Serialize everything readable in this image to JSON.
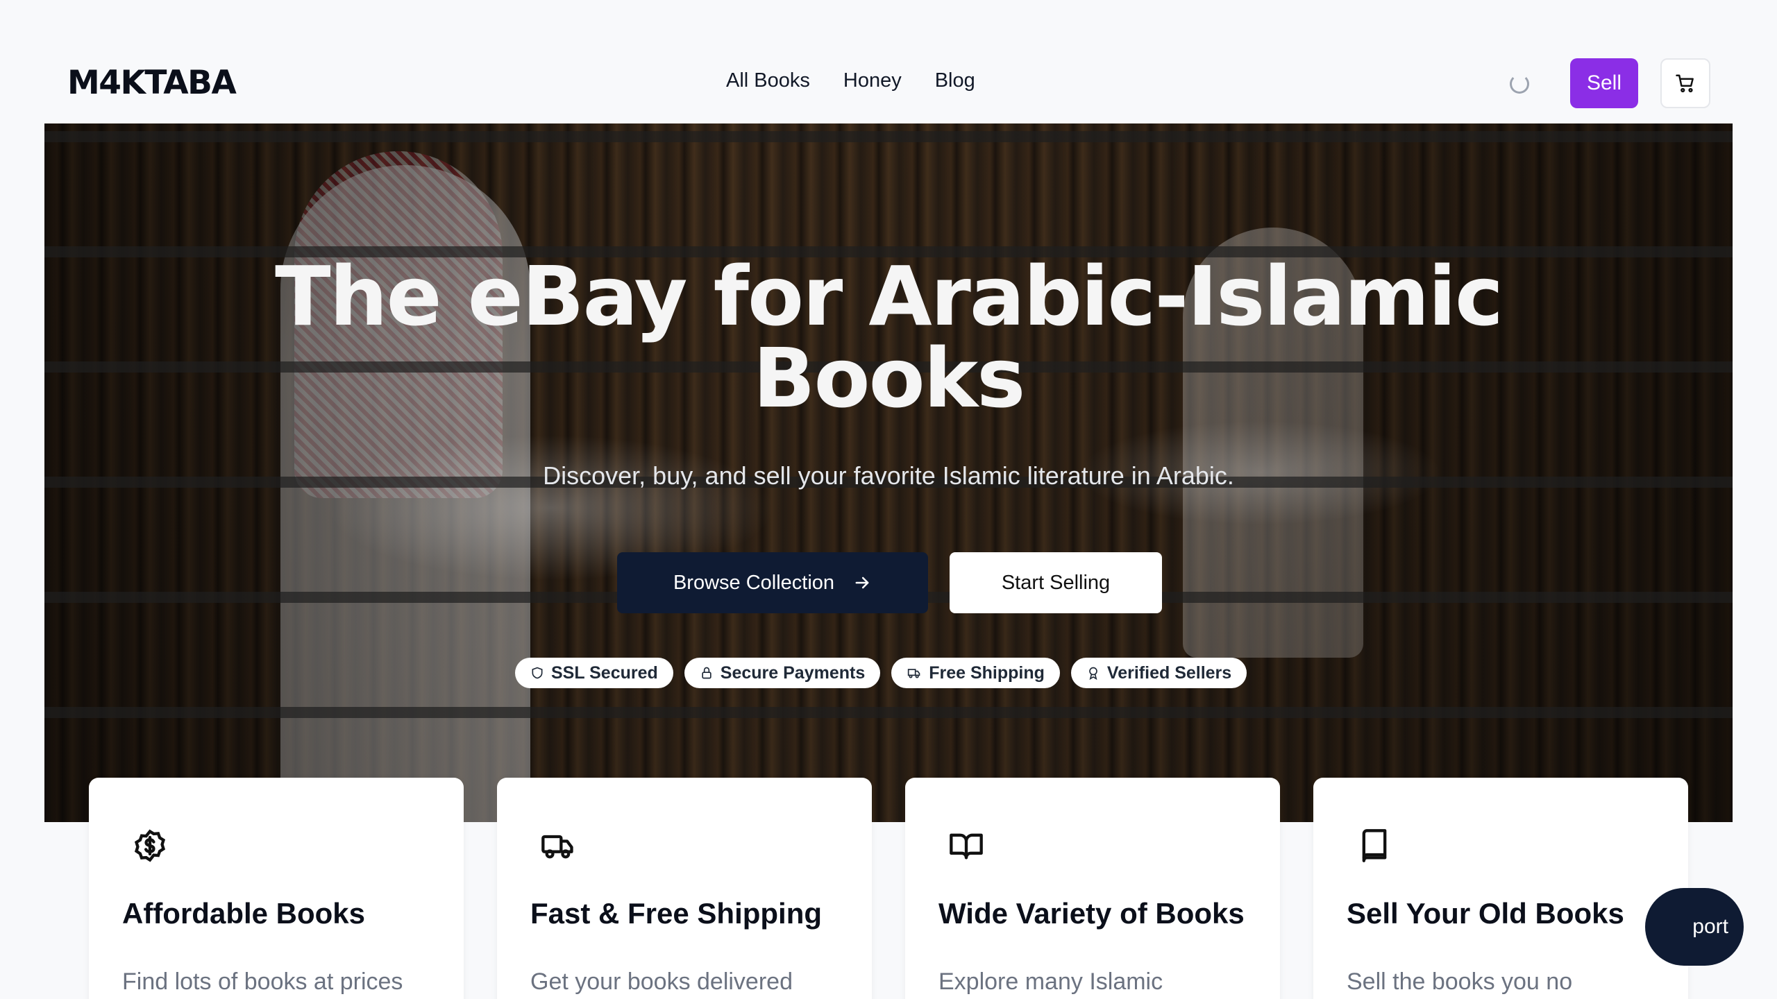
{
  "header": {
    "logo": "M4KTABA",
    "nav": [
      "All Books",
      "Honey",
      "Blog"
    ],
    "sell_label": "Sell"
  },
  "hero": {
    "title_line1": "The eBay for Arabic-Islamic",
    "title_line2": "Books",
    "subtitle": "Discover, buy, and sell your favorite Islamic literature in Arabic.",
    "browse_label": "Browse Collection",
    "start_label": "Start Selling",
    "badges": [
      "SSL Secured",
      "Secure Payments",
      "Free Shipping",
      "Verified Sellers"
    ]
  },
  "features": [
    {
      "title": "Affordable Books",
      "text": "Find lots of books at prices",
      "icon": "dollar-icon"
    },
    {
      "title": "Fast & Free Shipping",
      "text": "Get your books delivered",
      "icon": "truck-icon"
    },
    {
      "title": "Wide Variety of Books",
      "text": "Explore many Islamic",
      "icon": "open-book-icon"
    },
    {
      "title": "Sell Your Old Books",
      "text": "Sell the books you no",
      "icon": "book-icon"
    }
  ],
  "support_label": "port",
  "colors": {
    "accent": "#8b2ee6",
    "navy": "#0f1b33"
  }
}
